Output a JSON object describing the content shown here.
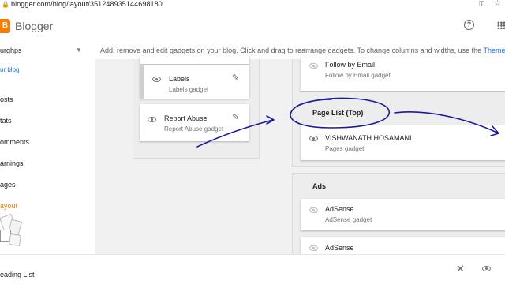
{
  "browser": {
    "url": "blogger.com/blog/layout/351248935144698180"
  },
  "app": {
    "name": "Blogger",
    "logo_letter": "B",
    "brand_color": "#f57d00"
  },
  "sidebar": {
    "blog_name": "urghps",
    "view_blog": "ur blog",
    "items": [
      {
        "label": "osts"
      },
      {
        "label": "tats"
      },
      {
        "label": "omments"
      },
      {
        "label": "arnings"
      },
      {
        "label": "ages"
      },
      {
        "label": "ayout",
        "active": true
      }
    ]
  },
  "main": {
    "info_text": "Add, remove and edit gadgets on your blog. Click and drag to rearrange gadgets. To change columns and widths, use the ",
    "info_link": "Theme E",
    "left_gadgets": [
      {
        "title": "Labels",
        "subtitle": "Labels gadget"
      },
      {
        "title": "Report Abuse",
        "subtitle": "Report Abuse gadget"
      }
    ],
    "follow_gadget": {
      "title": "Follow by Email",
      "subtitle": "Follow by Email gadget"
    },
    "page_list": {
      "section_title": "Page List (Top)",
      "gadget_title": "VISHWANATH HOSAMANI",
      "gadget_subtitle": "Pages gadget"
    },
    "ads": {
      "section_title": "Ads",
      "gadgets": [
        {
          "title": "AdSense",
          "subtitle": "AdSense gadget"
        },
        {
          "title": "AdSense",
          "subtitle": ""
        }
      ]
    }
  },
  "bottom": {
    "last_item": "eading List"
  },
  "icons": [
    "lock-icon",
    "key-icon",
    "star-icon",
    "help-icon",
    "apps-icon",
    "eye-icon",
    "eye-off-icon",
    "pencil-icon",
    "close-icon",
    "preview-icon"
  ],
  "annotation_color": "#1a1a9c"
}
